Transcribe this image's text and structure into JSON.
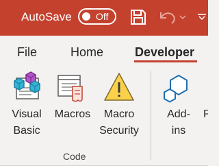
{
  "titlebar": {
    "autosave_label": "AutoSave",
    "autosave_state": "Off",
    "accent_color": "#c4412e"
  },
  "tabs": [
    {
      "label": "File"
    },
    {
      "label": "Home"
    },
    {
      "label": "Developer",
      "active": true
    }
  ],
  "ribbon": {
    "buttons": [
      {
        "line1": "Visual",
        "line2": "Basic",
        "icon": "visual-basic-icon"
      },
      {
        "line1": "Macros",
        "line2": "",
        "icon": "macros-icon"
      },
      {
        "line1": "Macro",
        "line2": "Security",
        "icon": "warning-icon"
      },
      {
        "line1": "Add-",
        "line2": "ins",
        "icon": "add-ins-icon"
      },
      {
        "line1": "P",
        "line2": "",
        "icon": ""
      }
    ],
    "group_label": "Code"
  }
}
